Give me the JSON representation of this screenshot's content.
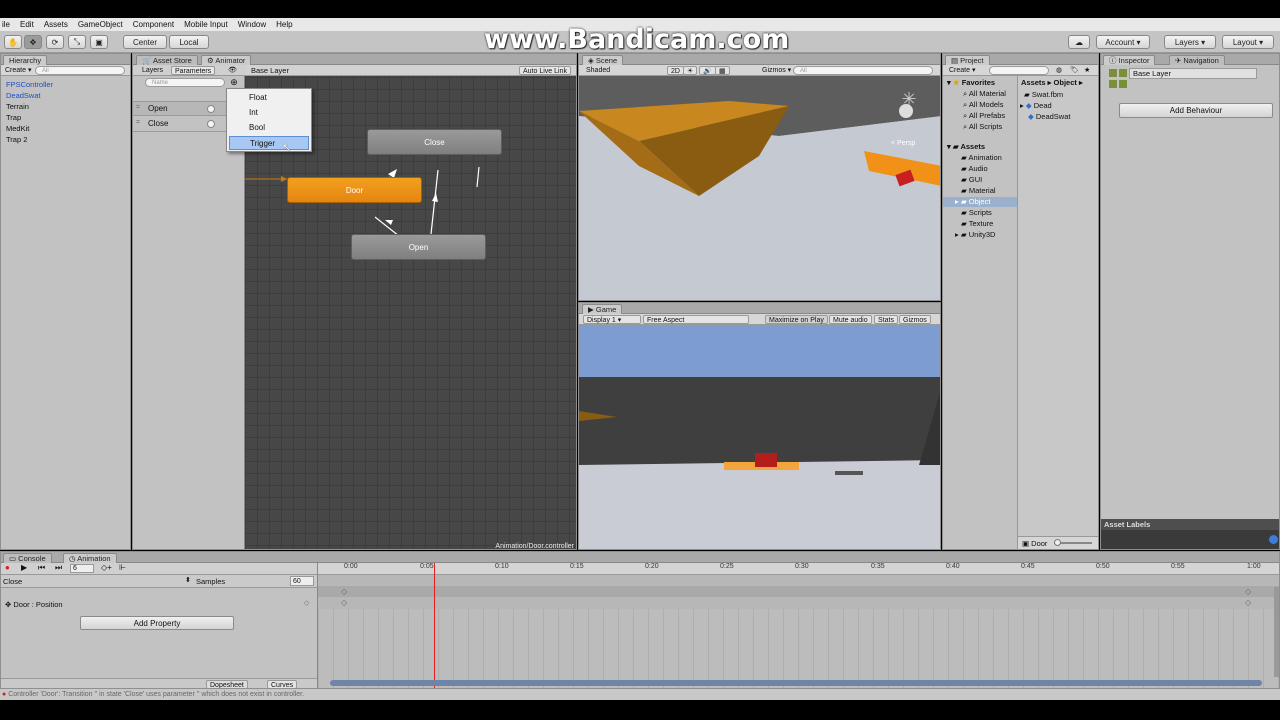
{
  "watermark": "www.Bandicam.com",
  "menu": [
    "ile",
    "Edit",
    "Assets",
    "GameObject",
    "Component",
    "Mobile Input",
    "Window",
    "Help"
  ],
  "toolbar": {
    "pivot": "Center",
    "space": "Local",
    "account": "Account",
    "layers": "Layers",
    "layout": "Layout"
  },
  "hierarchy": {
    "tab": "Hierarchy",
    "create": "Create",
    "search": "All",
    "items": [
      "FPSController",
      "DeadSwat",
      "Terrain",
      "Trap",
      "MedKit",
      "Trap 2"
    ]
  },
  "animator": {
    "tabs": [
      "Asset Store",
      "Animator"
    ],
    "sub_tabs": [
      "Layers",
      "Parameters"
    ],
    "search": "Name",
    "params": [
      "Open",
      "Close"
    ],
    "layer": "Base Layer",
    "auto_live": "Auto Live Link",
    "states": {
      "close": "Close",
      "door": "Door",
      "open": "Open"
    },
    "footer": "Animation/Door.controller",
    "dropdown": [
      "Float",
      "Int",
      "Bool",
      "Trigger"
    ]
  },
  "scene": {
    "tab": "Scene",
    "shading": "Shaded",
    "mode2d": "2D",
    "gizmos": "Gizmos",
    "search": "All",
    "persp": "< Persp"
  },
  "game": {
    "tab": "Game",
    "display": "Display 1",
    "aspect": "Free Aspect",
    "buttons": [
      "Maximize on Play",
      "Mute audio",
      "Stats",
      "Gizmos"
    ]
  },
  "project": {
    "tab": "Project",
    "create": "Create",
    "favorites_label": "Favorites",
    "favorites": [
      "All Material",
      "All Models",
      "All Prefabs",
      "All Scripts"
    ],
    "assets_label": "Assets",
    "folders": [
      "Animation",
      "Audio",
      "GUI",
      "Material",
      "Object",
      "Scripts",
      "Texture",
      "Unity3D"
    ],
    "breadcrumb": "Assets ▸ Object ▸",
    "files": [
      "Swat.fbm",
      "Dead",
      "DeadSwat"
    ],
    "footer": "Door"
  },
  "inspector": {
    "tabs": [
      "Inspector",
      "Navigation"
    ],
    "name": "Base Layer",
    "add_behaviour": "Add Behaviour",
    "asset_labels": "Asset Labels"
  },
  "animation": {
    "tabs": [
      "Console",
      "Animation"
    ],
    "frame": "6",
    "clip": "Close",
    "samples_label": "Samples",
    "samples": "60",
    "property": "Door : Position",
    "add_property": "Add Property",
    "dopesheet": "Dopesheet",
    "curves": "Curves",
    "ticks": [
      "0:00",
      "0:05",
      "0:10",
      "0:15",
      "0:20",
      "0:25",
      "0:30",
      "0:35",
      "0:40",
      "0:45",
      "0:50",
      "0:55",
      "1:00"
    ],
    "playhead_time": "0:06"
  },
  "status": "Controller 'Door': Transition '' in state 'Close' uses parameter '' which does not exist in controller.",
  "colors": {
    "accent": "#e88c12",
    "selection": "#a6c8f2",
    "playhead": "#e02020"
  }
}
